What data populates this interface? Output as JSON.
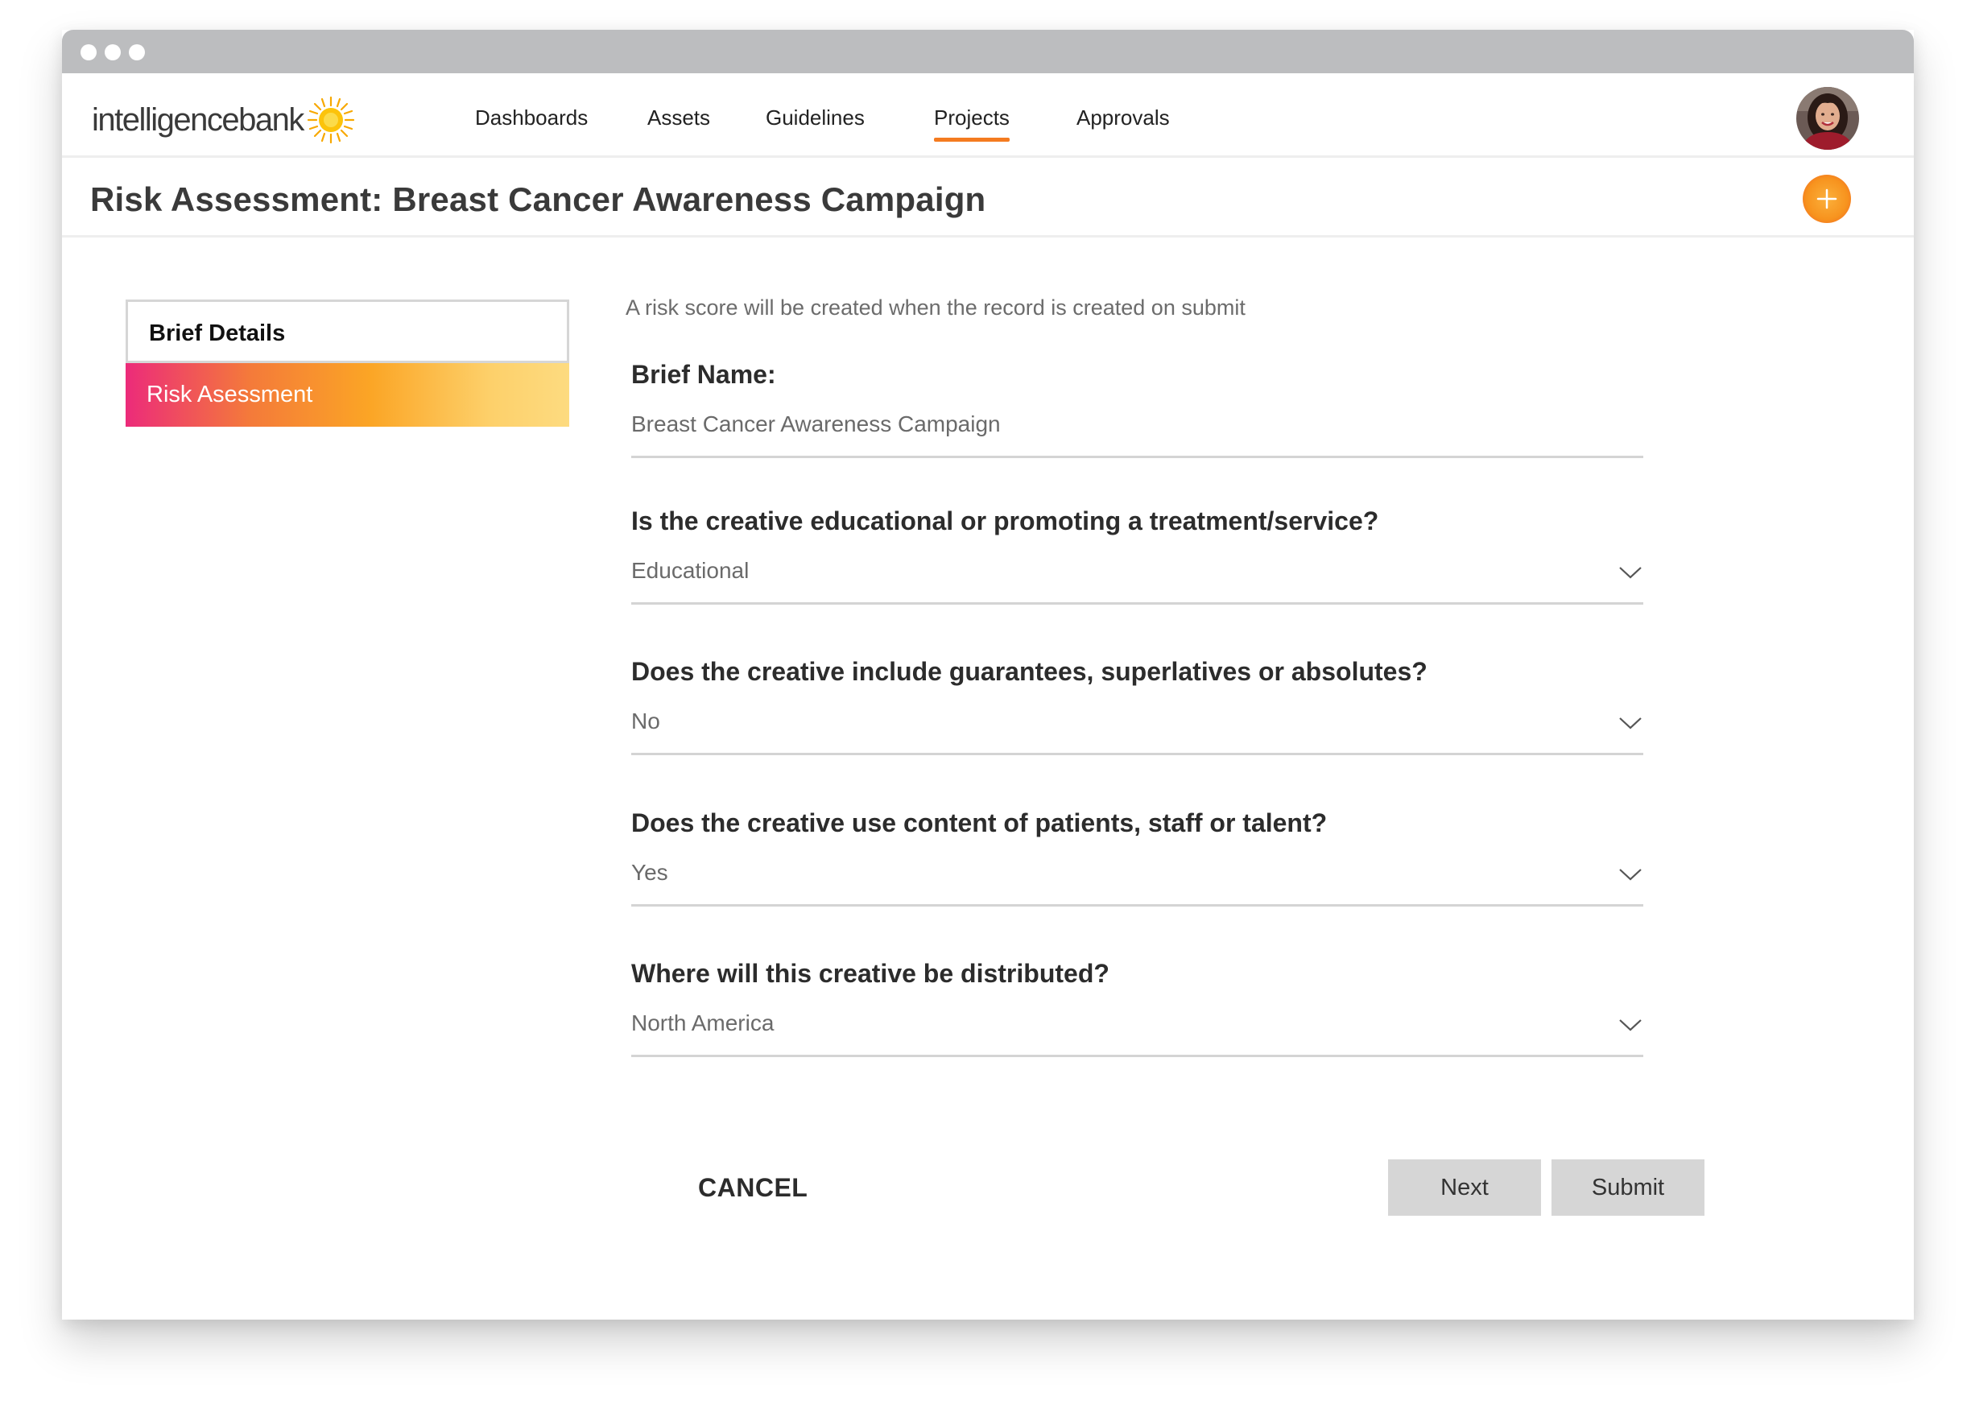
{
  "app": {
    "logo_text": "intelligencebank"
  },
  "nav": {
    "items": [
      {
        "label": "Dashboards",
        "active": false
      },
      {
        "label": "Assets",
        "active": false
      },
      {
        "label": "Guidelines",
        "active": false
      },
      {
        "label": "Projects",
        "active": true
      },
      {
        "label": "Approvals",
        "active": false
      }
    ],
    "avatar_icon": "user-avatar"
  },
  "page": {
    "title": "Risk Assessment: Breast Cancer Awareness Campaign",
    "add_icon": "plus-icon"
  },
  "sidebar": {
    "items": [
      {
        "label": "Brief Details",
        "active": false
      },
      {
        "label": "Risk Asessment",
        "active": true
      }
    ]
  },
  "form": {
    "notice": "A risk score will be created when the record is created on submit",
    "fields": [
      {
        "label": "Brief Name:",
        "value": "Breast Cancer Awareness Campaign",
        "type": "text"
      },
      {
        "label": "Is the creative educational or promoting a treatment/service?",
        "value": "Educational",
        "type": "select"
      },
      {
        "label": "Does the creative include guarantees, superlatives or absolutes?",
        "value": "No",
        "type": "select"
      },
      {
        "label": "Does the creative use content of patients, staff or talent?",
        "value": "Yes",
        "type": "select"
      },
      {
        "label": "Where will this creative be distributed?",
        "value": "North America",
        "type": "select"
      }
    ],
    "cancel_label": "CANCEL",
    "next_label": "Next",
    "submit_label": "Submit"
  },
  "colors": {
    "accent_orange": "#f47b20",
    "gradient_start": "#ec2b7a",
    "gradient_end": "#fddb80",
    "button_gray": "#d6d6d6"
  }
}
